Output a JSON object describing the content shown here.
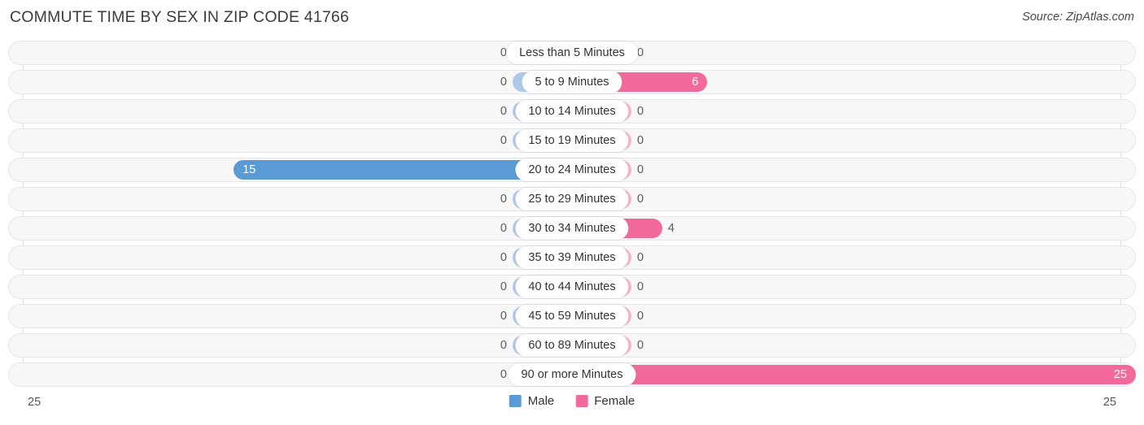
{
  "header": {
    "title": "COMMUTE TIME BY SEX IN ZIP CODE 41766",
    "source": "Source: ZipAtlas.com"
  },
  "axis": {
    "left_end": "25",
    "right_end": "25"
  },
  "legend": {
    "male_label": "Male",
    "female_label": "Female",
    "male_color": "#5b9bd5",
    "female_color": "#f2699c",
    "male_zero_color": "#aec8ea",
    "female_zero_color": "#f9b4cb"
  },
  "chart_data": {
    "type": "bar",
    "subtype": "diverging-bar",
    "title": "COMMUTE TIME BY SEX IN ZIP CODE 41766",
    "xlabel": "",
    "ylabel": "",
    "xlim": [
      25,
      0,
      25
    ],
    "axis_max": 25,
    "grid": false,
    "legend_position": "bottom-center",
    "categories": [
      "Less than 5 Minutes",
      "5 to 9 Minutes",
      "10 to 14 Minutes",
      "15 to 19 Minutes",
      "20 to 24 Minutes",
      "25 to 29 Minutes",
      "30 to 34 Minutes",
      "35 to 39 Minutes",
      "40 to 44 Minutes",
      "45 to 59 Minutes",
      "60 to 89 Minutes",
      "90 or more Minutes"
    ],
    "series": [
      {
        "name": "Male",
        "direction": "left",
        "values": [
          0,
          0,
          0,
          0,
          15,
          0,
          0,
          0,
          0,
          0,
          0,
          0
        ],
        "labels": [
          "0",
          "0",
          "0",
          "0",
          "15",
          "0",
          "0",
          "0",
          "0",
          "0",
          "0",
          "0"
        ]
      },
      {
        "name": "Female",
        "direction": "right",
        "values": [
          0,
          6,
          0,
          0,
          0,
          0,
          4,
          0,
          0,
          0,
          0,
          25
        ],
        "labels": [
          "0",
          "6",
          "0",
          "0",
          "0",
          "0",
          "4",
          "0",
          "0",
          "0",
          "0",
          "25"
        ]
      }
    ]
  }
}
